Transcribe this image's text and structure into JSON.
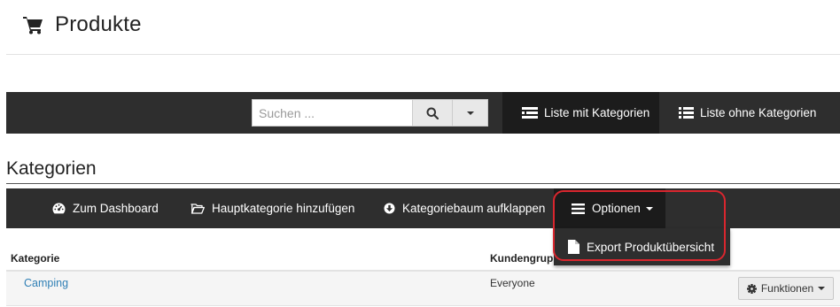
{
  "page": {
    "title": "Produkte",
    "title_icon": "shopping-cart-icon"
  },
  "toolbar": {
    "search": {
      "placeholder": "Suchen ...",
      "value": ""
    },
    "search_icon": "search-icon",
    "dropdown_icon": "caret-down-icon",
    "views": [
      {
        "label": "Liste mit Kategorien",
        "icon": "list-with-categories-icon",
        "active": true
      },
      {
        "label": "Liste ohne Kategorien",
        "icon": "list-icon",
        "active": false
      }
    ]
  },
  "section": {
    "title": "Kategorien"
  },
  "category_bar": {
    "items": [
      {
        "label": "Zum Dashboard",
        "icon": "dashboard-icon"
      },
      {
        "label": "Hauptkategorie hinzufügen",
        "icon": "folder-open-icon"
      },
      {
        "label": "Kategoriebaum aufklappen",
        "icon": "arrow-circle-down-icon"
      }
    ],
    "options": {
      "label": "Optionen",
      "icon": "bars-icon",
      "open": true
    },
    "dropdown_items": [
      {
        "label": "Export Produktübersicht",
        "icon": "file-icon"
      }
    ]
  },
  "table": {
    "columns": [
      "Kategorie",
      "Kundengrup"
    ],
    "rows": [
      {
        "kategorie": "Camping",
        "kundengruppe": "Everyone",
        "action_label": "Funktionen"
      }
    ]
  },
  "colors": {
    "bar_bg": "#2e2e2e",
    "active_bg": "#1c1c1c",
    "link": "#2f7fb5",
    "highlight": "#d9262e"
  }
}
